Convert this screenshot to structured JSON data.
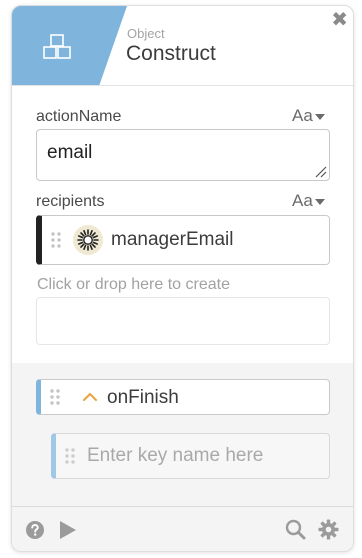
{
  "header": {
    "type_label": "Object",
    "title": "Construct",
    "accent_color": "#7fb5dc",
    "icon": "blocks-icon",
    "close_glyph": "✖"
  },
  "fields": {
    "action_name": {
      "label": "actionName",
      "format_toggle": "Aa",
      "value": "email"
    },
    "recipients": {
      "label": "recipients",
      "format_toggle": "Aa",
      "item_label": "managerEmail",
      "item_icon": "sunburst-icon"
    },
    "create_hint": "Click or drop here to create"
  },
  "events": {
    "on_finish": {
      "label": "onFinish",
      "caret_color": "#e8a33c",
      "key_placeholder": "Enter key name here"
    }
  },
  "footer": {
    "left_icons": [
      "help-icon",
      "play-icon"
    ],
    "right_icons": [
      "search-icon",
      "gear-icon"
    ]
  }
}
